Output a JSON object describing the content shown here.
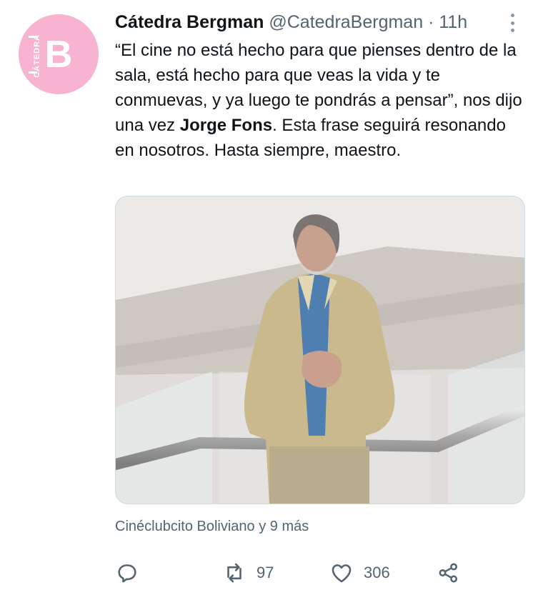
{
  "avatar": {
    "side_text": "CÁTEDRA",
    "letter": "B"
  },
  "tweet": {
    "author_name": "Cátedra Bergman",
    "author_handle": "@CatedraBergman",
    "separator": "·",
    "time": "11h",
    "text_before": "“El cine no está hecho para que pienses dentro de la sala, está hecho para que veas la vida y te conmuevas, y ya luego te pondrás a pensar”, nos dijo una vez ",
    "text_bold": "Jorge Fons",
    "text_after": ". Esta frase seguirá resonando en nosotros. Hasta siempre, maestro.",
    "social_context": "Cinéclubcito Boliviano y 9 más"
  },
  "actions": {
    "reply_icon": "reply-icon",
    "retweet_icon": "retweet-icon",
    "retweet_count": "97",
    "like_icon": "heart-icon",
    "like_count": "306",
    "share_icon": "share-icon"
  },
  "colors": {
    "avatar_bg": "#f7b3cf",
    "text": "#0f1419",
    "muted": "#536471"
  }
}
